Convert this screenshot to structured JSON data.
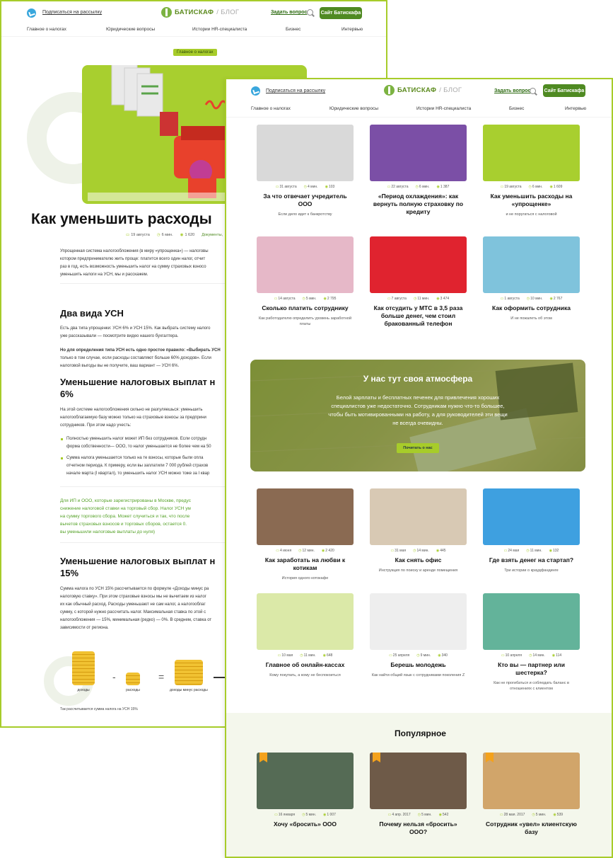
{
  "back_page": {
    "header": {
      "subscribe": "Подписаться на рассылку",
      "logo": "БАТИСКАФ",
      "logo_blog": "/ БЛОГ",
      "ask": "Задать вопрос",
      "site_button": "Сайт Батискафа"
    },
    "nav": [
      "Главное о налогах",
      "Юридические вопросы",
      "Истории HR-специалиста",
      "Бизнес",
      "Интервью"
    ],
    "category_chip": "Главное о налогах",
    "title": "Как уменьшить расходы",
    "meta": {
      "date": "19 августа",
      "read": "6 мин.",
      "views": "1 620",
      "docs": "Документы,"
    },
    "intro": [
      "Упрощенная система налогообложения (в миру «упрощенка») — налоговы",
      "котором предпринимателю жить проще: платится всего один налог, отчит",
      "раз в год, есть возможность уменьшить налог на сумму страховых взносо",
      "уменьшить налоги на УСН, мы и расскажем."
    ],
    "h2_1": "Два вида УСН",
    "p1": [
      "Есть два типа упрощенки: УСН 6% и УСН 15%. Как выбрать систему налого",
      "уже рассказывали — посмотрите видео нашего бухгалтера."
    ],
    "p2": [
      "Но для определения типа УСН есть одно простое правило: «Выбирать УСН",
      "только в том случае, если расходы составляют больше 60% доходов». Если",
      "налоговой выгоды вы не получите, ваш вариант — УСН 6%."
    ],
    "h2_2": "Уменьшение налоговых выплат н",
    "h2_2b": "6%",
    "p3": [
      "На этой системе налогообложения сильно не разгуляешься: уменьшить",
      "налогооблагаемую базу можно только на страховые взносы за предприни",
      "сотрудников. При этом надо учесть:"
    ],
    "li1": [
      "Полностью уменьшить налог может ИП без сотрудников. Если сотрудн",
      "форма собственности— ООО, то налог уменьшается не более чем на 50"
    ],
    "li2": [
      "Сумма налога уменьшается только на те взносы, которые были опла",
      "отчетном периода. К примеру, если вы заплатили 7 000 рублей страхов",
      "начале марта (I квартал), то уменьшить налог УСН можно тоже за I квар"
    ],
    "quote": [
      "Для ИП и ООО, которые зарегистрированы в Москве, предус",
      "снижение налоговой ставки на торговый сбор. Налог УСН ум",
      "на сумму торгового сбора. Может случиться и так, что после",
      "вычетов страховых взносов и торговых сборов, остается 0.",
      "вы уменьшили налоговые выплаты до нуля)"
    ],
    "h2_3": "Уменьшение налоговых выплат н",
    "h2_3b": "15%",
    "p4": [
      "Сумма налога по УСН 15% рассчитывается по формуле «Доходы минус ра",
      "налоговую ставку». При этом страховые взносы мы не вычитаем из налог",
      "их как обычный расход. Расходы уменьшают не сам налог, а налогооблаг",
      "сумму, с которой нужно рассчитать налог. Максимальная ставка по этой с",
      "налогообложения — 15%, минимальная (редко) — 0%. В среднем, ставка от",
      "зависимости от региона."
    ],
    "formula": {
      "a": "доходы",
      "b": "расходы",
      "c": "доходы минус расходы",
      "minus": "-",
      "eq": "="
    },
    "caption": "Так рассчитывается сумма налога на УСН 15%"
  },
  "front_page": {
    "header": {
      "subscribe": "Подписаться на рассылку",
      "logo": "БАТИСКАФ",
      "logo_blog": "/ БЛОГ",
      "ask": "Задать вопрос",
      "site_button": "Сайт Батискафа"
    },
    "nav": [
      "Главное о налогах",
      "Юридические вопросы",
      "Истории HR-специалиста",
      "Бизнес",
      "Интервью"
    ],
    "cards": [
      {
        "date": "31 августа",
        "read": "4 мин.",
        "views": "103",
        "title": "За что отвечает учредитель ООО",
        "desc": "Если дело идет к банкротству",
        "color": "#d9d9d9"
      },
      {
        "date": "22 августа",
        "read": "6 мин.",
        "views": "1 387",
        "title": "«Период охлаждения»: как вернуть полную страховку по кредиту",
        "desc": "",
        "color": "#7b4fa6"
      },
      {
        "date": "19 августа",
        "read": "6 мин.",
        "views": "1 609",
        "title": "Как уменьшить расходы на «упрощенке»",
        "desc": "и не поругаться с налоговой",
        "color": "#a8cf2f"
      },
      {
        "date": "14 августа",
        "read": "5 мин.",
        "views": "2 795",
        "title": "Сколько платить сотруднику",
        "desc": "Как работодателю определить уровень заработной платы",
        "color": "#e6b8c8"
      },
      {
        "date": "7 августа",
        "read": "11 мин.",
        "views": "3 474",
        "title": "Как отсудить у МТС в 3,5 раза больше денег, чем стоил бракованный телефон",
        "desc": "",
        "color": "#e0232f"
      },
      {
        "date": "1 августа",
        "read": "10 мин.",
        "views": "2 767",
        "title": "Как оформить сотрудника",
        "desc": "И не пожалеть об этом",
        "color": "#7fc3dc"
      },
      {
        "date": "4 июня",
        "read": "12 мин.",
        "views": "2 420",
        "title": "Как заработать на любви к котикам",
        "desc": "История одного котокафе",
        "color": "#8a6a52"
      },
      {
        "date": "31 мая",
        "read": "14 мин.",
        "views": "445",
        "title": "Как снять офис",
        "desc": "Инструкция по поиску и аренде помещения",
        "color": "#d8c9b4"
      },
      {
        "date": "24 мая",
        "read": "11 мин.",
        "views": "132",
        "title": "Где взять денег на стартап?",
        "desc": "Три истории о краудфандинге",
        "color": "#3ea0e0"
      },
      {
        "date": "10 мая",
        "read": "11 мин.",
        "views": "648",
        "title": "Главное об онлайн-кассах",
        "desc": "Кому покупать, а кому не беспокоиться",
        "color": "#dbe9a8"
      },
      {
        "date": "25 апреля",
        "read": "9 мин.",
        "views": "340",
        "title": "Берешь молодежь",
        "desc": "Как найти общий язык с сотрудниками поколения Z",
        "color": "#eeeeee"
      },
      {
        "date": "10 апреля",
        "read": "14 мин.",
        "views": "114",
        "title": "Кто вы — партнер или шестерка?",
        "desc": "Как не прогибаться и соблюдать баланс в отношениях с клиентом",
        "color": "#63b39a"
      }
    ],
    "banner": {
      "title": "У нас тут своя атмосфера",
      "text": "Белой зарплаты и бесплатных печенек для привлечения хороших специалистов уже недостаточно. Сотрудникам нужно что-то большее, чтобы быть мотивированными на работу, а для руководителей эти вещи не всегда очевидны.",
      "button": "Почитать о нас"
    },
    "popular": {
      "heading": "Популярное",
      "cards": [
        {
          "date": "16 января",
          "read": "5 мин.",
          "views": "1 007",
          "title": "Хочу «бросить» ООО",
          "color": "#556b55"
        },
        {
          "date": "4 апр. 2017",
          "read": "5 мин.",
          "views": "542",
          "title": "Почему нельзя «бросить» ООО?",
          "color": "#6e5a48"
        },
        {
          "date": "28 мая. 2017",
          "read": "5 мин.",
          "views": "539",
          "title": "Сотрудник «увел» клиентскую базу",
          "color": "#d1a56a"
        }
      ]
    }
  }
}
